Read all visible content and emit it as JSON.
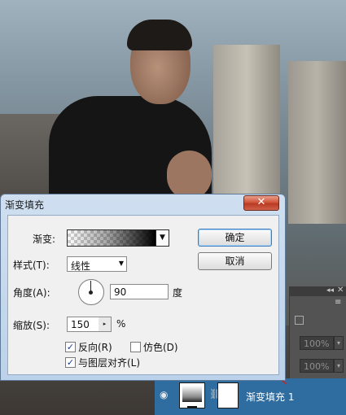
{
  "dialog": {
    "title": "渐变填充",
    "close_glyph": "✕",
    "gradient_label": "渐变:",
    "style_label": "样式(T):",
    "style_value": "线性",
    "angle_label": "角度(A):",
    "angle_value": "90",
    "angle_unit": "度",
    "scale_label": "缩放(S):",
    "scale_value": "150",
    "scale_unit": "%",
    "reverse_label": "反向(R)",
    "reverse_checked": true,
    "dither_label": "仿色(D)",
    "dither_checked": false,
    "align_label": "与图层对齐(L)",
    "align_checked": true,
    "ok_label": "确定",
    "cancel_label": "取消"
  },
  "layers_panel": {
    "opacity_value": "100%",
    "fill_value": "100%",
    "layer_name": "渐变填充 1",
    "collapse_glyph": "◂◂",
    "close_glyph": "✕",
    "menu_glyph": "≡"
  },
  "colors": {
    "dialog_frame": "#bcd2ea",
    "close_button": "#c8452b",
    "selected_layer": "#2f6c9f",
    "annotation_arrow": "#c0282a"
  }
}
